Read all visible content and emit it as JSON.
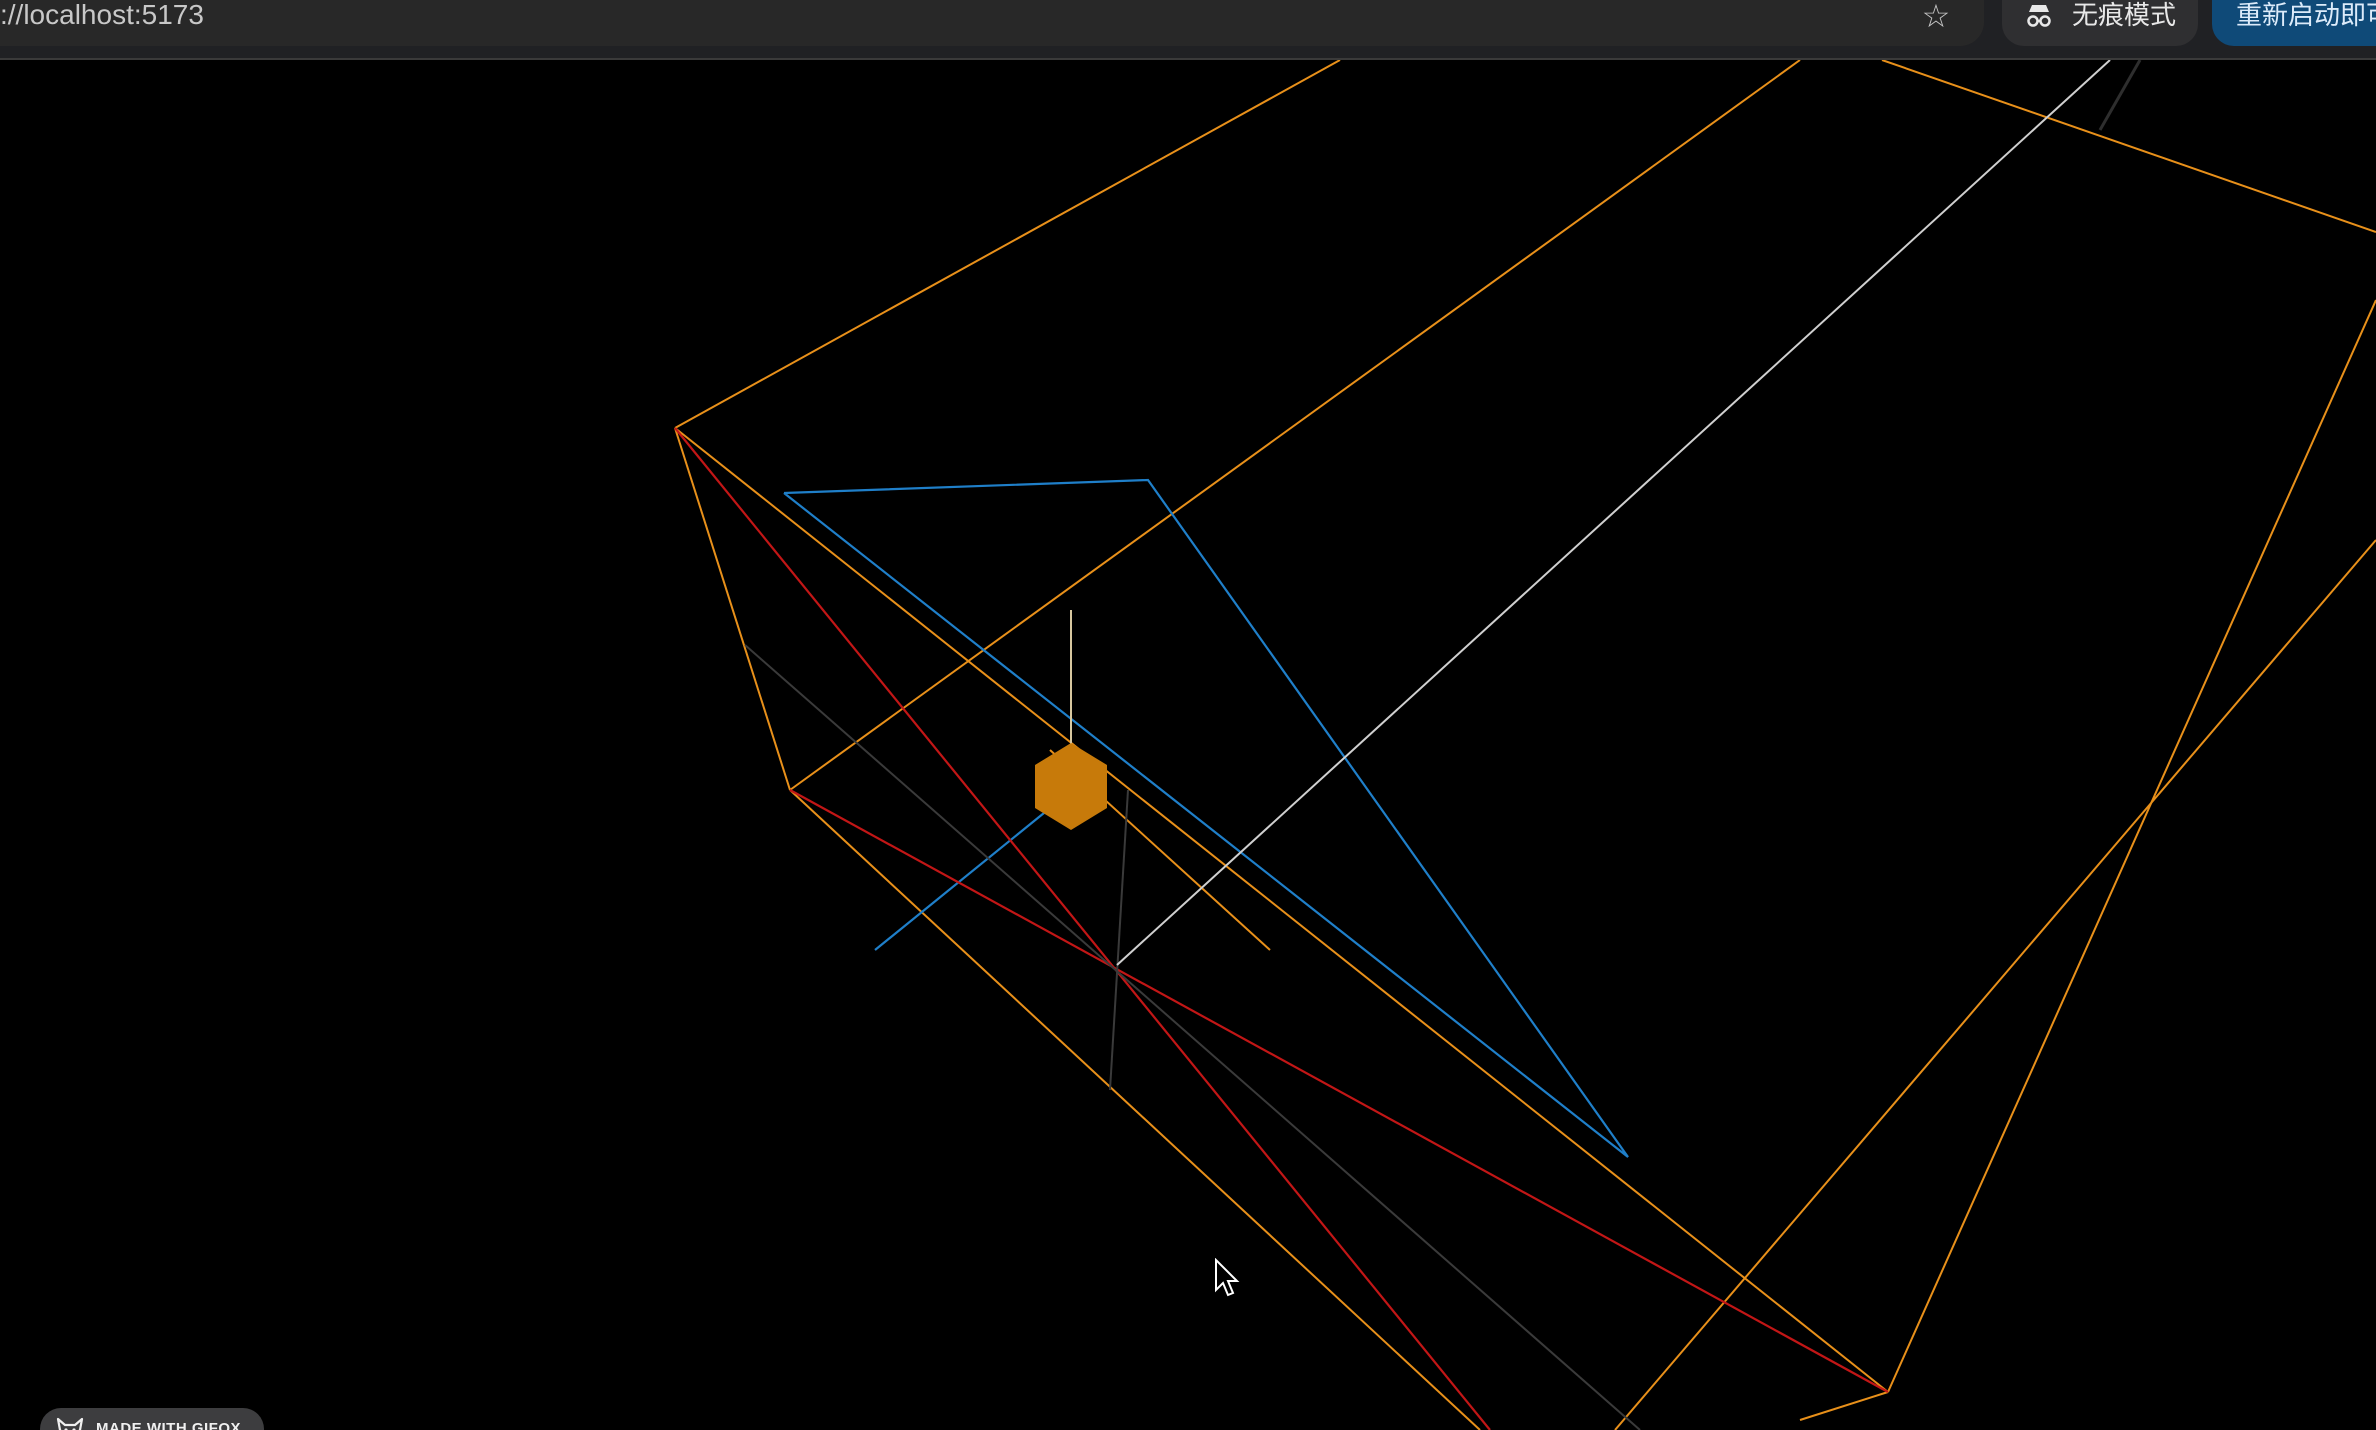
{
  "browser": {
    "url": "://localhost:5173",
    "incognito_label": "无痕模式",
    "relaunch_label": "重新启动即可",
    "star_icon": "bookmark-star-icon",
    "incognito_icon": "incognito-icon"
  },
  "watermark": {
    "label": "MADE WITH GIFOX",
    "icon": "gifox-fox-icon"
  },
  "scene": {
    "description_colors": {
      "frustum": "#e8901a",
      "blue_plane": "#1f7fc9",
      "red_lines": "#c21616",
      "white_axis": "#d0d0d0",
      "gray_axis": "#3a3a3a",
      "camera_marker": "#c77a0a"
    }
  }
}
